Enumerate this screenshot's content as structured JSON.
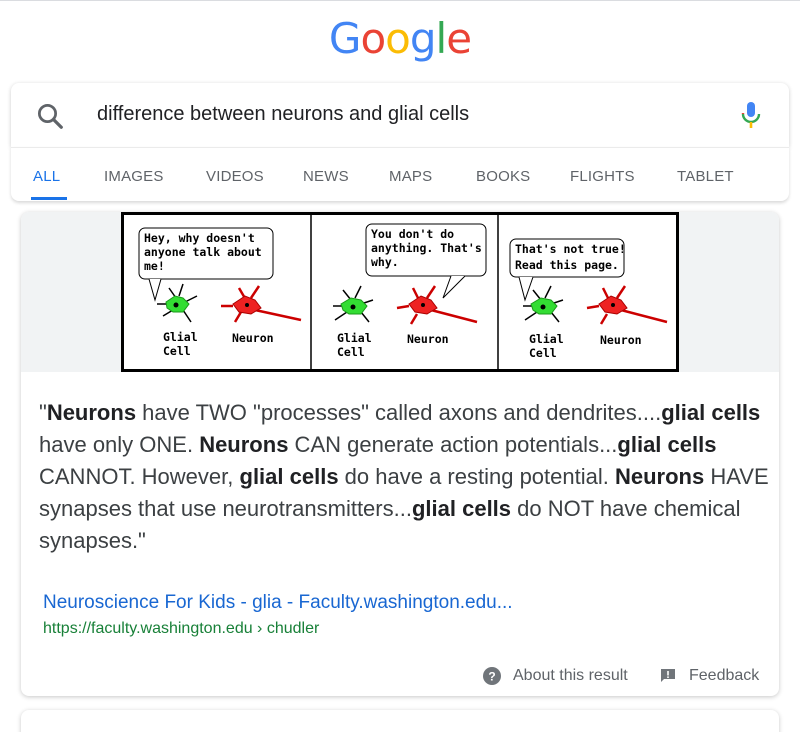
{
  "logo": {
    "letters": [
      "G",
      "o",
      "o",
      "g",
      "l",
      "e"
    ],
    "colors": [
      "#4285f4",
      "#ea4335",
      "#fbbc05",
      "#4285f4",
      "#34a853",
      "#ea4335"
    ]
  },
  "search": {
    "query": "difference between neurons and glial cells"
  },
  "tabs": [
    "ALL",
    "IMAGES",
    "VIDEOS",
    "NEWS",
    "MAPS",
    "BOOKS",
    "FLIGHTS",
    "TABLET"
  ],
  "comic": {
    "panel1_bubble": [
      "Hey, why doesn't",
      "anyone talk about",
      "me!"
    ],
    "panel2_bubble": [
      "You don't do",
      "anything.  That's",
      "why."
    ],
    "panel3_bubble": [
      "That's not true!",
      "Read this page."
    ],
    "glial_label": [
      "Glial",
      "Cell"
    ],
    "neuron_label": "Neuron"
  },
  "snippet": {
    "quote_open": "\"",
    "s1": "Neurons",
    "s2": " have TWO \"processes\" called axons and dendrites....",
    "s3": "glial cells",
    "s4": " have only ONE. ",
    "s5": "Neurons",
    "s6": " CAN generate action potentials...",
    "s7": "glial cells",
    "s8": " CANNOT. However, ",
    "s9": "glial cells",
    "s10": " do have a resting potential. ",
    "s11": "Neurons",
    "s12": " HAVE synapses that use neurotransmitters...",
    "s13": "glial cells",
    "s14": " do NOT have chemical synapses.\""
  },
  "result": {
    "title": "Neuroscience For Kids - glia - Faculty.washington.edu...",
    "url": "https://faculty.washington.edu › chudler"
  },
  "footer": {
    "about": "About this result",
    "feedback": "Feedback"
  }
}
